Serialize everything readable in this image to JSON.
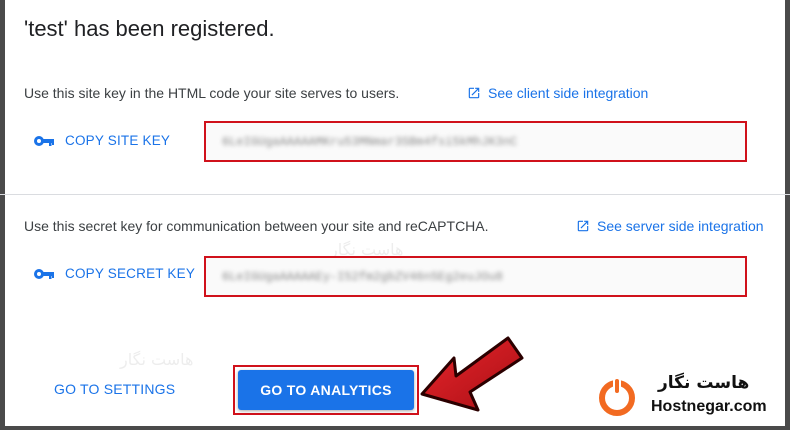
{
  "header": {
    "title": "'test' has been registered."
  },
  "site_key": {
    "description": "Use this site key in the HTML code your site serves to users.",
    "link_label": "See client side integration",
    "copy_label": "COPY SITE KEY",
    "value": "6LeIGUgaAAAAAMKru53MNmar3SBm4fsi5kMhJK3nC"
  },
  "secret_key": {
    "description": "Use this secret key for communication between your site and reCAPTCHA.",
    "link_label": "See server side integration",
    "copy_label": "COPY SECRET KEY",
    "value": "6LeIGUgaAAAAAEy-I52fm2gbZV46n5Eg2euJOu8"
  },
  "footer": {
    "settings_label": "GO TO SETTINGS",
    "analytics_label": "GO TO ANALYTICS"
  },
  "watermark": {
    "brand_fa": "هاست نگار",
    "brand_en": "Hostnegar.com"
  },
  "colors": {
    "accent": "#1a73e8",
    "highlight": "#d0111b",
    "arrow": "#c8161d",
    "logo": "#f26a21"
  },
  "icons": {
    "key": "key-icon",
    "external_link": "open-in-new-icon",
    "arrow": "pointer-arrow-icon",
    "logo": "hostnegar-logo-icon"
  }
}
